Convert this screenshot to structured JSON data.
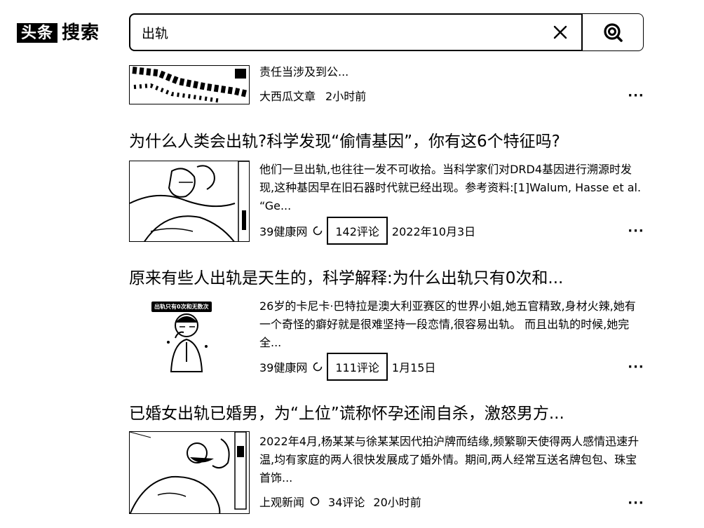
{
  "header": {
    "logo_box": "头条",
    "logo_text": "搜索",
    "search": {
      "value": "出轨",
      "placeholder": ""
    }
  },
  "results": [
    {
      "title": "",
      "snippet": "责任当涉及到公...",
      "source": "大西瓜文章",
      "comments": "",
      "time": "2小时前"
    },
    {
      "title": "为什么人类会出轨?科学发现“偷情基因”，你有这6个特征吗?",
      "snippet": "他们一旦出轨,也往往一发不可收拾。当科学家们对DRD4基因进行溯源时发现,这种基因早在旧石器时代就已经出现。参考资料:[1]Walum, Hasse et al. “Ge...",
      "source": "39健康网",
      "comments": "142评论",
      "time": "2022年10月3日"
    },
    {
      "title": "原来有些人出轨是天生的，科学解释:为什么出轨只有0次和...",
      "snippet": "26岁的卡尼卡·巴特拉是澳大利亚赛区的世界小姐,她五官精致,身材火辣,她有一个奇怪的癖好就是很难坚持一段恋情,很容易出轨。 而且出轨的时候,她完全...",
      "source": "39健康网",
      "comments": "111评论",
      "time": "1月15日",
      "thumb_caption": "出轨只有0次和无数次"
    },
    {
      "title": "已婚女出轨已婚男，为“上位”谎称怀孕还闹自杀，激怒男方...",
      "snippet": "2022年4月,杨某某与徐某某因代拍沪牌而结缘,频繁聊天使得两人感情迅速升温,均有家庭的两人很快发展成了婚外情。期间,两人经常互送名牌包包、珠宝首饰...",
      "source": "上观新闻",
      "comments": "34评论",
      "time": "20小时前"
    }
  ],
  "more_label": "···"
}
